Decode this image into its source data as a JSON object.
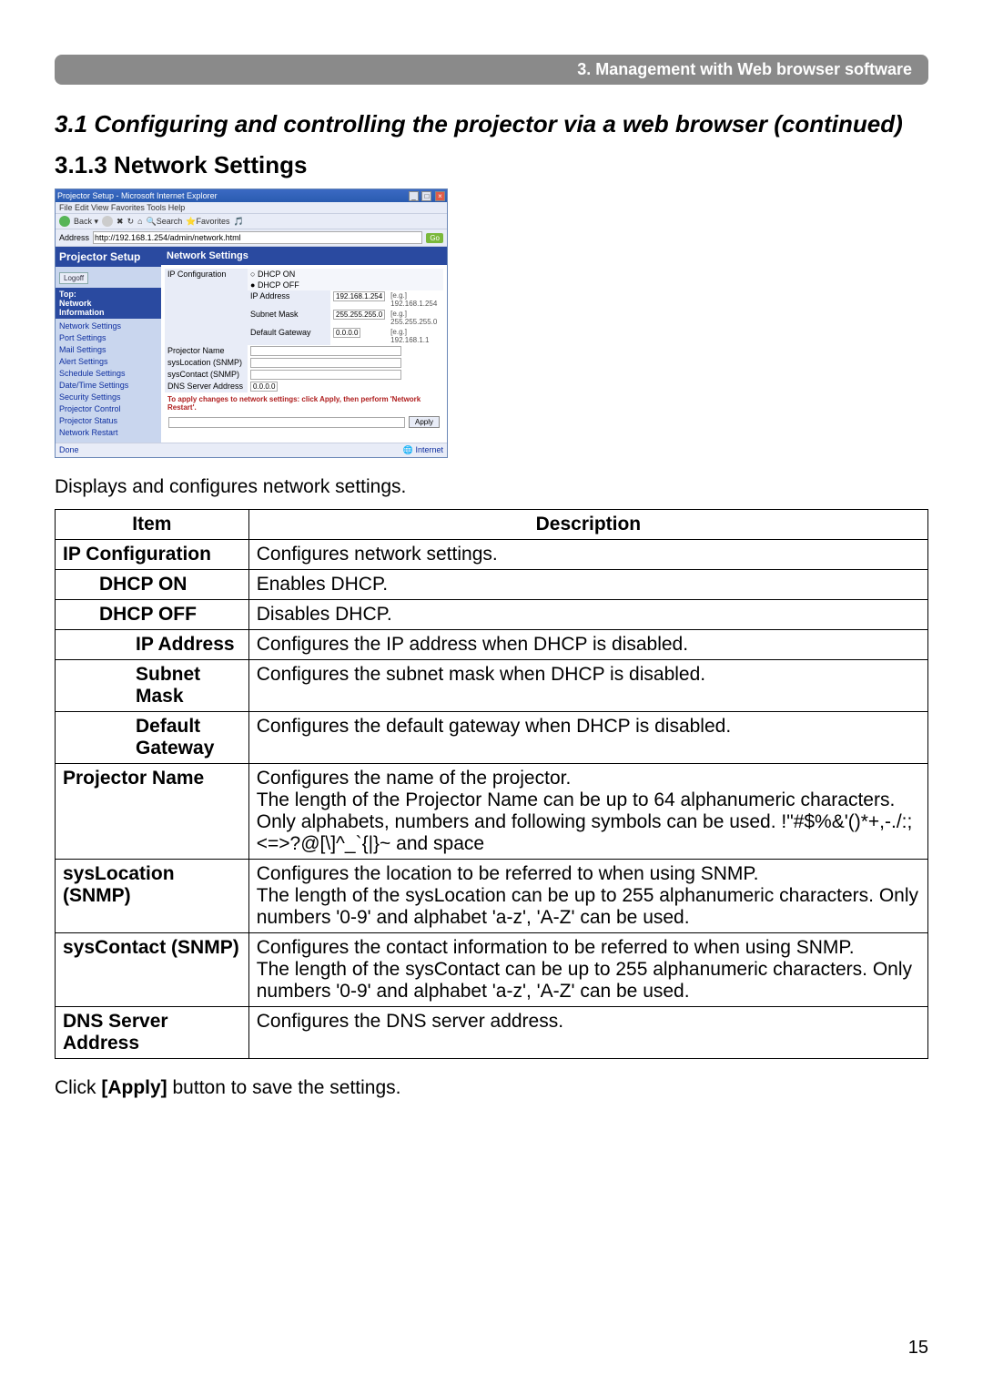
{
  "chapter_bar": "3. Management with Web browser software",
  "section_title": "3.1 Configuring and controlling the projector via a web browser (continued)",
  "subsection_title": "3.1.3 Network Settings",
  "intro_text": "Displays and configures network settings.",
  "closing_text_prefix": "Click ",
  "closing_text_bold": "[Apply]",
  "closing_text_suffix": " button to save the settings.",
  "page_number": "15",
  "table": {
    "head_item": "Item",
    "head_desc": "Description",
    "rows": {
      "ipconfig": {
        "item": "IP Configuration",
        "desc": "Configures network settings."
      },
      "dhcpon": {
        "item": "DHCP ON",
        "desc": "Enables DHCP."
      },
      "dhcpoff": {
        "item": "DHCP OFF",
        "desc": "Disables DHCP."
      },
      "ipaddr": {
        "item": "IP Address",
        "desc": "Configures the IP address when DHCP is disabled."
      },
      "subnet": {
        "item": "Subnet Mask",
        "desc": "Configures the subnet mask when DHCP is disabled."
      },
      "gateway": {
        "item": "Default Gateway",
        "desc": "Configures the default gateway when DHCP is disabled."
      },
      "projname": {
        "item": "Projector Name",
        "desc": "Configures the name of the projector.\nThe length of the Projector Name can be up to 64 alphanumeric characters. Only alphabets, numbers and following symbols can be used.  !\"#$%&'()*+,-./:;<=>?@[\\]^_`{|}~ and space"
      },
      "sysloc": {
        "item": "sysLocation (SNMP)",
        "desc": "Configures the location to be referred to when using SNMP.\nThe length of the sysLocation can be up to 255 alphanumeric characters. Only numbers '0-9' and alphabet 'a-z', 'A-Z' can be used."
      },
      "syscon": {
        "item": "sysContact (SNMP)",
        "desc": "Configures the contact information to be referred to when using SNMP.\nThe length of the sysContact can be up to 255 alphanumeric characters. Only numbers '0-9' and alphabet 'a-z', 'A-Z' can be used."
      },
      "dns": {
        "item": "DNS Server Address",
        "desc": "Configures the DNS  server address."
      }
    }
  },
  "screenshot": {
    "window_title": "Projector Setup - Microsoft Internet Explorer",
    "menubar": "File   Edit   View   Favorites   Tools   Help",
    "toolbar": {
      "search": "Search",
      "fav": "Favorites"
    },
    "address": "http://192.168.1.254/admin/network.html",
    "go": "Go",
    "proj_setup": "Projector Setup",
    "logoff": "Logoff",
    "top_block": "Top:\nNetwork\nInformation",
    "nav": [
      "Network Settings",
      "Port Settings",
      "Mail Settings",
      "Alert Settings",
      "Schedule Settings",
      "Date/Time Settings",
      "Security Settings",
      "Projector Control",
      "Projector Status",
      "Network Restart"
    ],
    "content_hdr": "Network Settings",
    "ipconf_lbl": "IP Configuration",
    "dhcp_on": "DHCP ON",
    "dhcp_off": "DHCP OFF",
    "ip_lbl": "IP Address",
    "ip_val": "192.168.1.254",
    "ip_eg": "[e.g.] 192.168.1.254",
    "sm_lbl": "Subnet Mask",
    "sm_val": "255.255.255.0",
    "sm_eg": "[e.g.] 255.255.255.0",
    "gw_lbl": "Default Gateway",
    "gw_val": "0.0.0.0",
    "gw_eg": "[e.g.] 192.168.1.1",
    "pn_lbl": "Projector Name",
    "sl_lbl": "sysLocation (SNMP)",
    "sc_lbl": "sysContact (SNMP)",
    "dns_lbl": "DNS Server Address",
    "dns_val": "0.0.0.0",
    "warn": "To apply changes to network settings: click Apply, then perform 'Network Restart'.",
    "apply": "Apply",
    "status_left": "Done",
    "status_right": "Internet"
  }
}
